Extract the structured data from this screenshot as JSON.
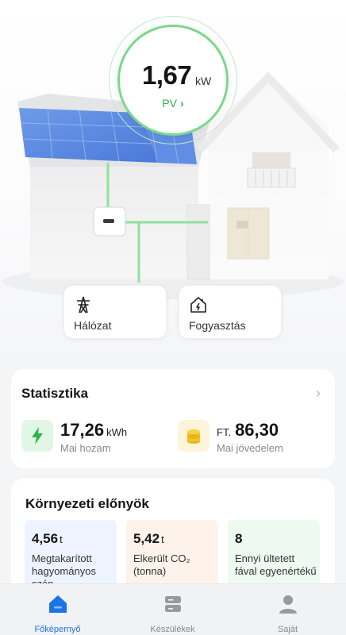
{
  "power": {
    "value": "1,67",
    "unit": "kW",
    "pv_label": "PV",
    "pv_chevron": "›"
  },
  "tiles": [
    {
      "label": "Hálózat",
      "icon": "power-tower-icon"
    },
    {
      "label": "Fogyasztás",
      "icon": "home-consumption-icon"
    }
  ],
  "stats": {
    "title": "Statisztika",
    "chevron": "›",
    "yield": {
      "value": "17,26",
      "unit": "kWh",
      "label": "Mai hozam",
      "icon": "lightning-icon"
    },
    "income": {
      "prefix": "FT.",
      "value": "86,30",
      "label": "Mai jövedelem",
      "icon": "coins-icon"
    }
  },
  "env": {
    "title": "Környezeti előnyök",
    "items": [
      {
        "value": "4,56",
        "unit": "t",
        "desc": "Megtakarított hagyományos szén",
        "bg": "#eef4ff"
      },
      {
        "value": "5,42",
        "unit": "t",
        "desc_html": "Elkerült CO₂ (tonna)",
        "bg": "#fdf3ea"
      },
      {
        "value": "8",
        "unit": "",
        "desc": "Ennyi ültetett fával egyenértékű",
        "bg": "#eefaf1"
      }
    ]
  },
  "tabs": [
    {
      "label": "Főképernyő",
      "icon": "home-icon",
      "active": true
    },
    {
      "label": "Készülékek",
      "icon": "devices-icon",
      "active": false
    },
    {
      "label": "Saját",
      "icon": "user-icon",
      "active": false
    }
  ],
  "colors": {
    "accent_green": "#2fb24a",
    "flow_line": "#8ee29b",
    "active_tab": "#1a73e8"
  }
}
